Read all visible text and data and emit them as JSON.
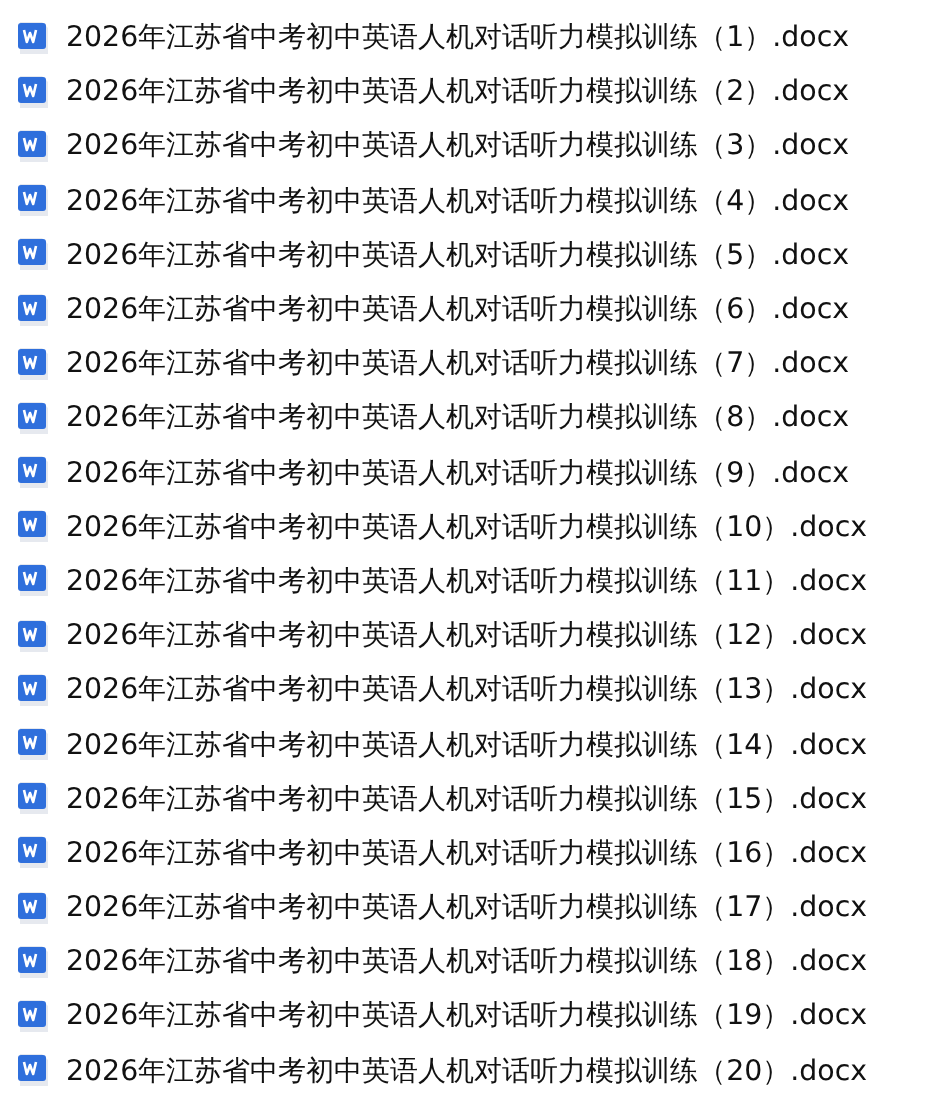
{
  "files": [
    {
      "name": "2026年江苏省中考初中英语人机对话听力模拟训练（1）.docx"
    },
    {
      "name": "2026年江苏省中考初中英语人机对话听力模拟训练（2）.docx"
    },
    {
      "name": "2026年江苏省中考初中英语人机对话听力模拟训练（3）.docx"
    },
    {
      "name": "2026年江苏省中考初中英语人机对话听力模拟训练（4）.docx"
    },
    {
      "name": "2026年江苏省中考初中英语人机对话听力模拟训练（5）.docx"
    },
    {
      "name": "2026年江苏省中考初中英语人机对话听力模拟训练（6）.docx"
    },
    {
      "name": "2026年江苏省中考初中英语人机对话听力模拟训练（7）.docx"
    },
    {
      "name": "2026年江苏省中考初中英语人机对话听力模拟训练（8）.docx"
    },
    {
      "name": "2026年江苏省中考初中英语人机对话听力模拟训练（9）.docx"
    },
    {
      "name": "2026年江苏省中考初中英语人机对话听力模拟训练（10）.docx"
    },
    {
      "name": "2026年江苏省中考初中英语人机对话听力模拟训练（11）.docx"
    },
    {
      "name": "2026年江苏省中考初中英语人机对话听力模拟训练（12）.docx"
    },
    {
      "name": "2026年江苏省中考初中英语人机对话听力模拟训练（13）.docx"
    },
    {
      "name": "2026年江苏省中考初中英语人机对话听力模拟训练（14）.docx"
    },
    {
      "name": "2026年江苏省中考初中英语人机对话听力模拟训练（15）.docx"
    },
    {
      "name": "2026年江苏省中考初中英语人机对话听力模拟训练（16）.docx"
    },
    {
      "name": "2026年江苏省中考初中英语人机对话听力模拟训练（17）.docx"
    },
    {
      "name": "2026年江苏省中考初中英语人机对话听力模拟训练（18）.docx"
    },
    {
      "name": "2026年江苏省中考初中英语人机对话听力模拟训练（19）.docx"
    },
    {
      "name": "2026年江苏省中考初中英语人机对话听力模拟训练（20）.docx"
    }
  ]
}
